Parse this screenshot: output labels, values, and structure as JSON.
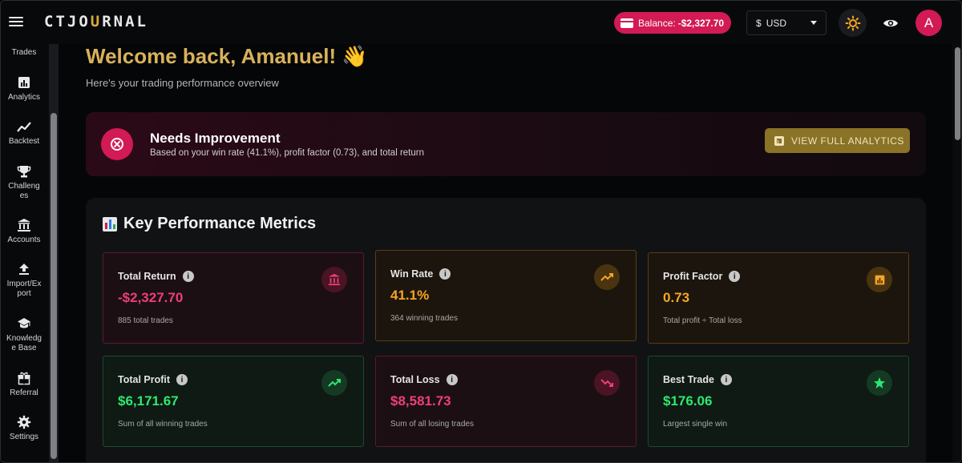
{
  "header": {
    "logo_pre": "CTJO",
    "logo_accent": "U",
    "logo_post": "RNAL",
    "balance_label": "Balance:",
    "balance_value": "-$2,327.70",
    "currency_symbol": "$",
    "currency_value": "USD",
    "avatar_initial": "A"
  },
  "sidebar": {
    "items": [
      {
        "label": "Trades",
        "icon": "trades-icon"
      },
      {
        "label": "Analytics",
        "icon": "bar-chart-icon"
      },
      {
        "label": "Backtest",
        "icon": "trend-line-icon"
      },
      {
        "label": "Challeng\nes",
        "icon": "trophy-icon"
      },
      {
        "label": "Accounts",
        "icon": "bank-icon"
      },
      {
        "label": "Import/Ex\nport",
        "icon": "upload-icon"
      },
      {
        "label": "Knowledg\ne Base",
        "icon": "graduation-cap-icon"
      },
      {
        "label": "Referral",
        "icon": "gift-icon"
      },
      {
        "label": "Settings",
        "icon": "gear-icon"
      }
    ]
  },
  "main": {
    "welcome": "Welcome back, Amanuel! 👋",
    "subtitle": "Here's your trading performance overview",
    "alert": {
      "title": "Needs Improvement",
      "description": "Based on your win rate (41.1%), profit factor (0.73), and total return",
      "button_label": "VIEW FULL ANALYTICS"
    },
    "metrics_heading": "Key Performance Metrics",
    "metrics": [
      {
        "label": "Total Return",
        "value": "-$2,327.70",
        "sub": "885 total trades",
        "tone": "red",
        "icon": "bank-icon"
      },
      {
        "label": "Win Rate",
        "value": "41.1%",
        "sub": "364 winning trades",
        "tone": "orange",
        "icon": "trending-up-icon"
      },
      {
        "label": "Profit Factor",
        "value": "0.73",
        "sub": "Total profit ÷ Total loss",
        "tone": "orange",
        "icon": "bar-chart-icon"
      },
      {
        "label": "Total Profit",
        "value": "$6,171.67",
        "sub": "Sum of all winning trades",
        "tone": "green",
        "icon": "trending-up-icon"
      },
      {
        "label": "Total Loss",
        "value": "$8,581.73",
        "sub": "Sum of all losing trades",
        "tone": "red",
        "icon": "trending-down-icon"
      },
      {
        "label": "Best Trade",
        "value": "$176.06",
        "sub": "Largest single win",
        "tone": "green",
        "icon": "star-icon"
      }
    ]
  },
  "colors": {
    "accent_gold": "#d9b25a",
    "danger": "#d21a55",
    "profit": "#2ee86f",
    "warning": "#f5a623"
  }
}
